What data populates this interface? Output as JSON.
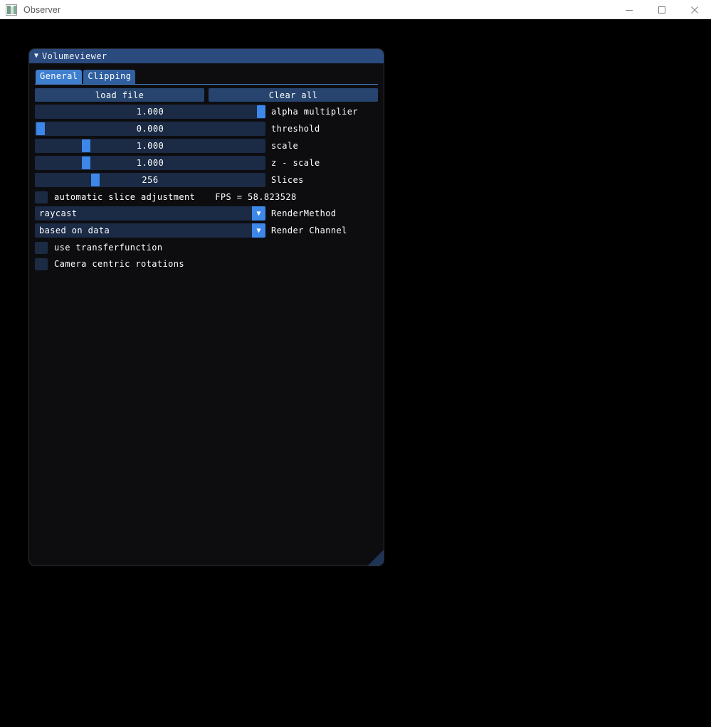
{
  "window": {
    "title": "Observer",
    "icon": "image-icon",
    "controls": [
      {
        "name": "minimize-button",
        "glyph": "minimize"
      },
      {
        "name": "maximize-button",
        "glyph": "maximize"
      },
      {
        "name": "close-button",
        "glyph": "close"
      }
    ]
  },
  "panel": {
    "title": "Volumeviewer",
    "collapse_icon": "▼",
    "tabs": [
      {
        "label": "General",
        "selected": true
      },
      {
        "label": "Clipping",
        "selected": false
      }
    ],
    "buttons": {
      "load_file": "load file",
      "clear_all": "Clear all"
    },
    "sliders": [
      {
        "label": "alpha multiplier",
        "value": "1.000",
        "handle_pct": 96.5
      },
      {
        "label": "threshold",
        "value": "0.000",
        "handle_pct": 0.6
      },
      {
        "label": "scale",
        "value": "1.000",
        "handle_pct": 20.5
      },
      {
        "label": "z - scale",
        "value": "1.000",
        "handle_pct": 20.5
      },
      {
        "label": "Slices",
        "value": "256",
        "handle_pct": 24.6
      }
    ],
    "auto_slice": {
      "label": "automatic slice adjustment",
      "checked": false,
      "fps": "FPS = 58.823528"
    },
    "dropdowns": [
      {
        "label": "RenderMethod",
        "value": "raycast",
        "arrow": "▼"
      },
      {
        "label": "Render Channel",
        "value": "based on data",
        "arrow": "▼"
      }
    ],
    "checkboxes": [
      {
        "label": "use transferfunction",
        "checked": false
      },
      {
        "label": "Camera centric rotations",
        "checked": false
      }
    ],
    "resize_grip": "resize-grip-icon"
  },
  "colors": {
    "header_blue": "#2b4a7e",
    "tab_selected": "#3f7fd0",
    "tab_unselected": "#2f5f9e",
    "button": "#27446e",
    "track": "#1b2a45",
    "handle": "#3d87e8",
    "panel_bg": "#0d0d10",
    "client_bg": "#000000"
  }
}
